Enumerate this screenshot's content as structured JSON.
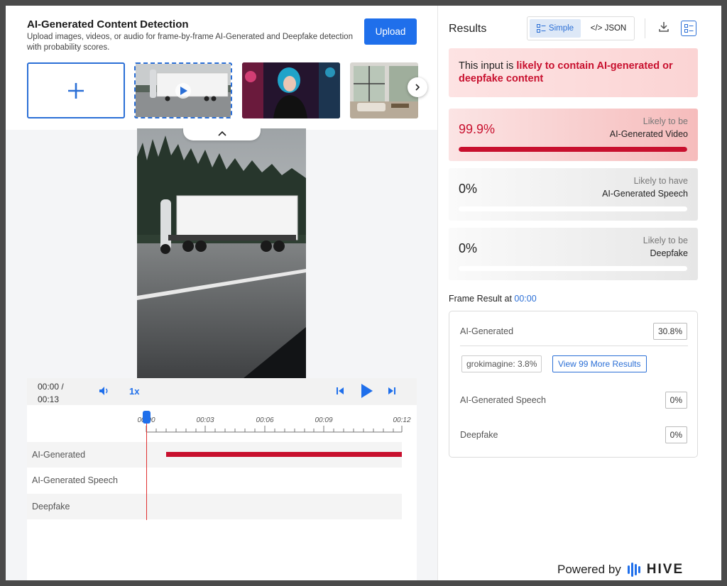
{
  "app": {
    "title": "AI-Generated Content Detection",
    "subtitle": "Upload images, videos, or audio for frame-by-frame AI-Generated and Deepfake detection with probability scores.",
    "upload_label": "Upload"
  },
  "gallery": {
    "add_icon": "plus-icon",
    "next_icon": "chevron-right-icon",
    "collapse_icon": "chevron-up-icon"
  },
  "player": {
    "current_time": "00:00 /",
    "duration": "00:13",
    "speed": "1x",
    "ticks": [
      "00:00",
      "00:03",
      "00:06",
      "00:09",
      "00:12"
    ],
    "tracks": [
      "AI-Generated",
      "AI-Generated Speech",
      "Deepfake"
    ]
  },
  "results": {
    "title": "Results",
    "view_simple": "Simple",
    "view_json": "</> JSON",
    "banner_prefix": "This input is ",
    "banner_highlight": "likely to contain AI-generated or deepfake content",
    "cards": [
      {
        "pct": "99.9%",
        "line1": "Likely to be",
        "line2": "AI-Generated Video",
        "level": 0.999
      },
      {
        "pct": "0%",
        "line1": "Likely to have",
        "line2": "AI-Generated Speech",
        "level": 0
      },
      {
        "pct": "0%",
        "line1": "Likely to be",
        "line2": "Deepfake",
        "level": 0
      }
    ],
    "frame_result_label": "Frame Result at ",
    "frame_result_time": "00:00",
    "frame": {
      "ai_generated_label": "AI-Generated",
      "ai_generated_value": "30.8%",
      "chip": "grokimagine: 3.8%",
      "more_button": "View 99 More Results",
      "speech_label": "AI-Generated Speech",
      "speech_value": "0%",
      "deepfake_label": "Deepfake",
      "deepfake_value": "0%"
    }
  },
  "footer": {
    "powered_by": "Powered by",
    "brand": "HIVE"
  },
  "colors": {
    "accent": "#1f6feb",
    "danger": "#c8102e"
  }
}
